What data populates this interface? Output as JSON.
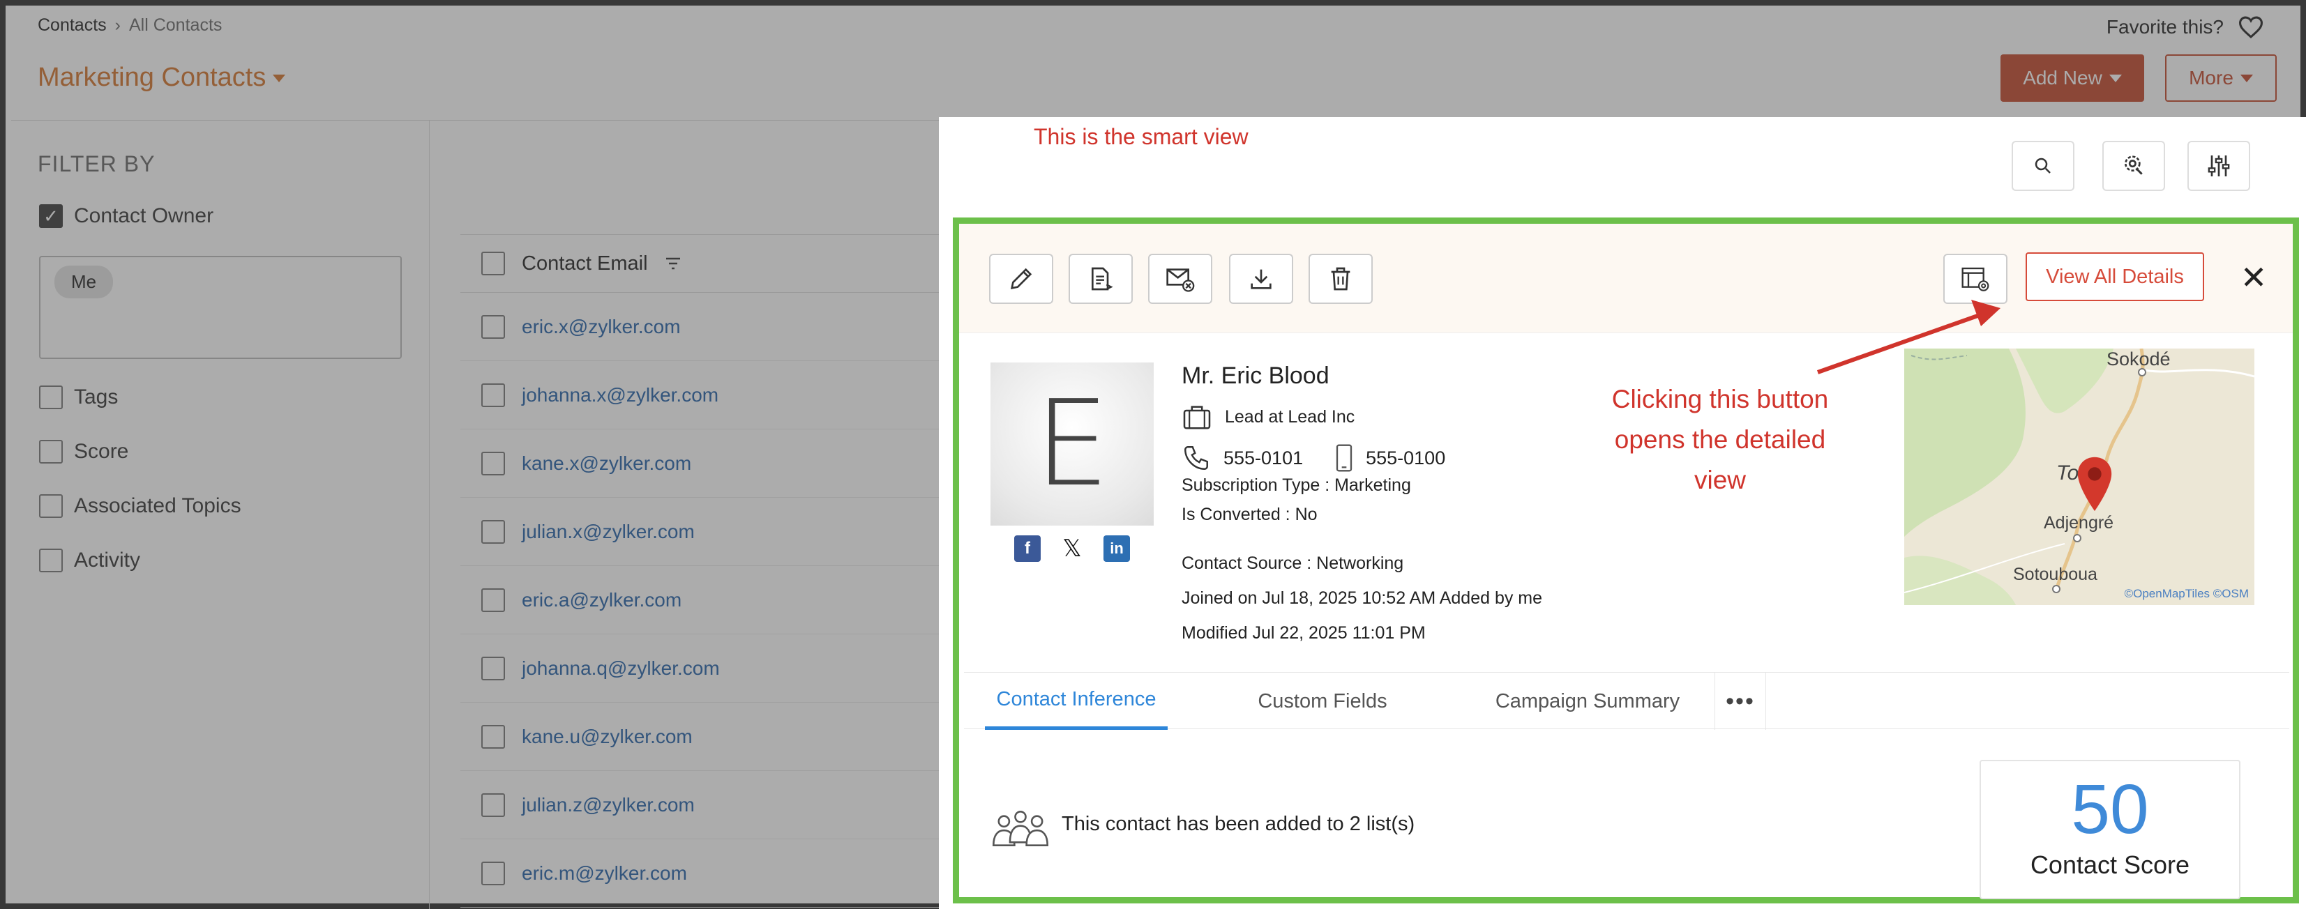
{
  "background": {
    "breadcrumb": {
      "root": "Contacts",
      "current": "All Contacts"
    },
    "page_title": "Marketing Contacts",
    "favorite_label": "Favorite this?",
    "add_new_label": "Add New",
    "more_label": "More",
    "filter": {
      "title": "FILTER BY",
      "contact_owner_label": "Contact Owner",
      "owner_chip": "Me",
      "tags_label": "Tags",
      "score_label": "Score",
      "topics_label": "Associated Topics",
      "activity_label": "Activity"
    },
    "list": {
      "header": "Contact Email",
      "emails": [
        "eric.x@zylker.com",
        "johanna.x@zylker.com",
        "kane.x@zylker.com",
        "julian.x@zylker.com",
        "eric.a@zylker.com",
        "johanna.q@zylker.com",
        "kane.u@zylker.com",
        "julian.z@zylker.com",
        "eric.m@zylker.com"
      ]
    }
  },
  "smart_view": {
    "note": "This is the smart view",
    "view_all_label": "View All Details",
    "close_glyph": "✕",
    "callout": "Clicking this button opens the detailed view",
    "contact": {
      "initial": "E",
      "name": "Mr. Eric Blood",
      "designation": "Lead at Lead Inc",
      "phone": "555-0101",
      "mobile": "555-0100",
      "subscription": "Subscription Type : Marketing",
      "converted": "Is Converted : No",
      "source": "Contact Source  : Networking",
      "joined": "Joined on Jul 18, 2025 10:52 AM Added by me",
      "modified": "Modified Jul 22, 2025 11:01 PM"
    },
    "map": {
      "label_top": "Sokodé",
      "label_partial": "To",
      "label_mid": "Adjengré",
      "label_bottom": "Sotouboua",
      "credit": "©OpenMapTiles ©OSM"
    },
    "tabs": [
      "Contact Inference",
      "Custom Fields",
      "Campaign Summary"
    ],
    "tab_more": "•••",
    "lists_text": "This contact has been added to 2 list(s)",
    "score": {
      "value": "50",
      "label": "Contact Score"
    },
    "colors": {
      "accent": "#2e86d9",
      "highlight_frame": "#6cc04a",
      "annotation": "#d0342c",
      "brand": "#c4472a"
    }
  }
}
